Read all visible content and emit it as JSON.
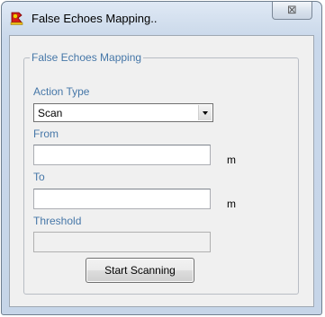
{
  "window": {
    "title": "False Echoes Mapping..",
    "close_symbol": "⊠",
    "icon": "red-radar-app-icon"
  },
  "group": {
    "title": "False Echoes Mapping",
    "action_type": {
      "label": "Action Type",
      "value": "Scan"
    },
    "from": {
      "label": "From",
      "value": "",
      "unit": "m"
    },
    "to": {
      "label": "To",
      "value": "",
      "unit": "m"
    },
    "threshold": {
      "label": "Threshold",
      "value": ""
    },
    "start_button": "Start Scanning"
  },
  "colors": {
    "label_blue": "#4677a8",
    "client_bg": "#f0f0f0",
    "frame": "#c9d8eb"
  }
}
